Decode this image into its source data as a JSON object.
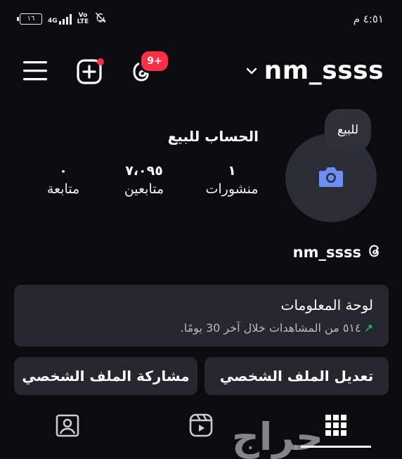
{
  "status_bar": {
    "battery": "١٦",
    "network": "4G",
    "volte_top": "Vo",
    "volte_bottom": "LTE",
    "time": "٤:٥١ م"
  },
  "header": {
    "username": "nm_ssss",
    "notification_badge": "9+"
  },
  "profile": {
    "note": "للبيع",
    "display_name": "الحساب للبيع",
    "stats": [
      {
        "value": "١",
        "label": "منشورات"
      },
      {
        "value": "٧،٠٩٥",
        "label": "متابعين"
      },
      {
        "value": "٠",
        "label": "متابعة"
      }
    ],
    "threads_username": "nm_ssss"
  },
  "dashboard": {
    "title": "لوحة المعلومات",
    "subtitle": "٥١٤ من المشاهدات خلال آخر 30 يومًا.",
    "trend_arrow": "↗"
  },
  "actions": {
    "edit_profile": "تعديل الملف الشخصي",
    "share_profile": "مشاركة الملف الشخصي"
  },
  "watermark": "حراج",
  "colors": {
    "background": "#0b0b10",
    "card": "#25262e",
    "badge": "#ff2f45",
    "camera_icon": "#6e8ef7",
    "trend": "#2ecc71"
  }
}
